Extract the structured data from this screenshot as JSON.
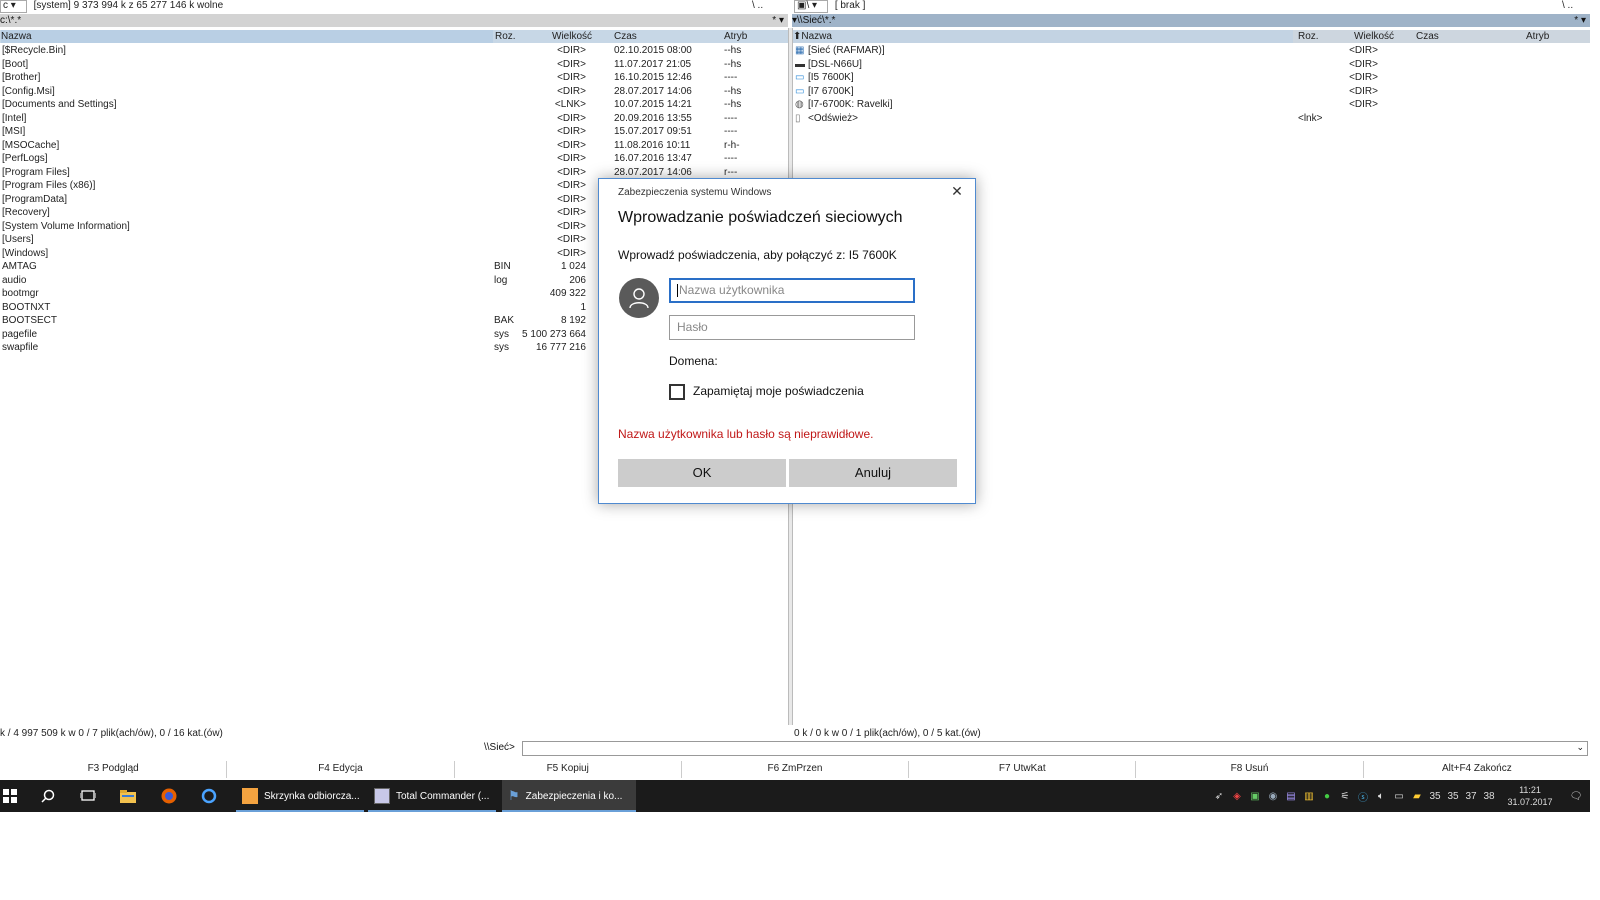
{
  "left_panel": {
    "drive": "c",
    "drive_info": "[system]  9 373 994 k z 65 277 146 k wolne",
    "path": "c:\\*.*",
    "path_symbols": "* ▾",
    "columns": [
      "Nazwa",
      "Roz.",
      "Wielkość",
      "Czas",
      "Atryb"
    ],
    "rows": [
      {
        "name": "[$Recycle.Bin]",
        "ext": "",
        "size": "<DIR>",
        "time": "02.10.2015 08:00",
        "attr": "--hs"
      },
      {
        "name": "[Boot]",
        "ext": "",
        "size": "<DIR>",
        "time": "11.07.2017 21:05",
        "attr": "--hs"
      },
      {
        "name": "[Brother]",
        "ext": "",
        "size": "<DIR>",
        "time": "16.10.2015 12:46",
        "attr": "----"
      },
      {
        "name": "[Config.Msi]",
        "ext": "",
        "size": "<DIR>",
        "time": "28.07.2017 14:06",
        "attr": "--hs"
      },
      {
        "name": "[Documents and Settings]",
        "ext": "",
        "size": "<LNK>",
        "time": "10.07.2015 14:21",
        "attr": "--hs"
      },
      {
        "name": "[Intel]",
        "ext": "",
        "size": "<DIR>",
        "time": "20.09.2016 13:55",
        "attr": "----"
      },
      {
        "name": "[MSI]",
        "ext": "",
        "size": "<DIR>",
        "time": "15.07.2017 09:51",
        "attr": "----"
      },
      {
        "name": "[MSOCache]",
        "ext": "",
        "size": "<DIR>",
        "time": "11.08.2016 10:11",
        "attr": "r-h-"
      },
      {
        "name": "[PerfLogs]",
        "ext": "",
        "size": "<DIR>",
        "time": "16.07.2016 13:47",
        "attr": "----"
      },
      {
        "name": "[Program Files]",
        "ext": "",
        "size": "<DIR>",
        "time": "28.07.2017 14:06",
        "attr": "r---"
      },
      {
        "name": "[Program Files (x86)]",
        "ext": "",
        "size": "<DIR>",
        "time": "",
        "attr": ""
      },
      {
        "name": "[ProgramData]",
        "ext": "",
        "size": "<DIR>",
        "time": "",
        "attr": ""
      },
      {
        "name": "[Recovery]",
        "ext": "",
        "size": "<DIR>",
        "time": "",
        "attr": ""
      },
      {
        "name": "[System Volume Information]",
        "ext": "",
        "size": "<DIR>",
        "time": "",
        "attr": ""
      },
      {
        "name": "[Users]",
        "ext": "",
        "size": "<DIR>",
        "time": "",
        "attr": ""
      },
      {
        "name": "[Windows]",
        "ext": "",
        "size": "<DIR>",
        "time": "",
        "attr": ""
      },
      {
        "name": "AMTAG",
        "ext": "BIN",
        "size": "1 024",
        "time": "",
        "attr": ""
      },
      {
        "name": "audio",
        "ext": "log",
        "size": "206",
        "time": "",
        "attr": ""
      },
      {
        "name": "bootmgr",
        "ext": "",
        "size": "409 322",
        "time": "",
        "attr": ""
      },
      {
        "name": "BOOTNXT",
        "ext": "",
        "size": "1",
        "time": "",
        "attr": ""
      },
      {
        "name": "BOOTSECT",
        "ext": "BAK",
        "size": "8 192",
        "time": "",
        "attr": ""
      },
      {
        "name": "pagefile",
        "ext": "sys",
        "size": "5 100 273 664",
        "time": "",
        "attr": ""
      },
      {
        "name": "swapfile",
        "ext": "sys",
        "size": "16 777 216",
        "time": "",
        "attr": ""
      }
    ],
    "status": "k / 4 997 509 k w 0 / 7 plik(ach/ów), 0 / 16 kat.(ów)"
  },
  "right_panel": {
    "drive_info": "[ brak ]",
    "path": "\\\\Sieć\\*.*",
    "path_symbols": "* ▾",
    "columns": [
      "Nazwa",
      "Roz.",
      "Wielkość",
      "Czas",
      "Atryb"
    ],
    "rows": [
      {
        "name": "[Sieć (RAFMAR)]",
        "ext": "",
        "size": "<DIR>"
      },
      {
        "name": "[DSL-N66U]",
        "ext": "",
        "size": "<DIR>"
      },
      {
        "name": "[I5 7600K]",
        "ext": "",
        "size": "<DIR>"
      },
      {
        "name": "[I7 6700K]",
        "ext": "",
        "size": "<DIR>"
      },
      {
        "name": "[I7-6700K: Ravelki]",
        "ext": "",
        "size": "<DIR>"
      },
      {
        "name": "<Odśwież>",
        "ext": "<lnk>",
        "size": ""
      }
    ],
    "status": "0 k / 0 k w 0 / 1 plik(ach/ów), 0 / 5 kat.(ów)"
  },
  "command_line": {
    "label": "\\\\Sieć>",
    "value": ""
  },
  "function_keys": [
    "F3 Podgląd",
    "F4 Edycja",
    "F5 Kopiuj",
    "F6 ZmPrzen",
    "F7 UtwKat",
    "F8 Usuń",
    "Alt+F4 Zakończ"
  ],
  "dialog": {
    "caption": "Zabezpieczenia systemu Windows",
    "title": "Wprowadzanie poświadczeń sieciowych",
    "subtitle": "Wprowadź poświadczenia, aby połączyć z: I5 7600K",
    "username_placeholder": "Nazwa użytkownika",
    "password_placeholder": "Hasło",
    "domain_label": "Domena:",
    "remember_label": "Zapamiętaj moje poświadczenia",
    "remember_checked": false,
    "error": "Nazwa użytkownika lub hasło są nieprawidłowe.",
    "ok_label": "OK",
    "cancel_label": "Anuluj"
  },
  "taskbar": {
    "apps": [
      {
        "label": "Skrzynka odbiorcza..."
      },
      {
        "label": "Total Commander (..."
      },
      {
        "label": "Zabezpieczenia i ko..."
      }
    ],
    "tray_temps": [
      "35",
      "35",
      "37",
      "38"
    ],
    "time": "11:21",
    "date": "31.07.2017"
  },
  "colors": {
    "accent": "#2a6fc7",
    "error": "#c01818",
    "taskbar": "#1b1b1b",
    "dialog_border": "#4f8ad0"
  }
}
